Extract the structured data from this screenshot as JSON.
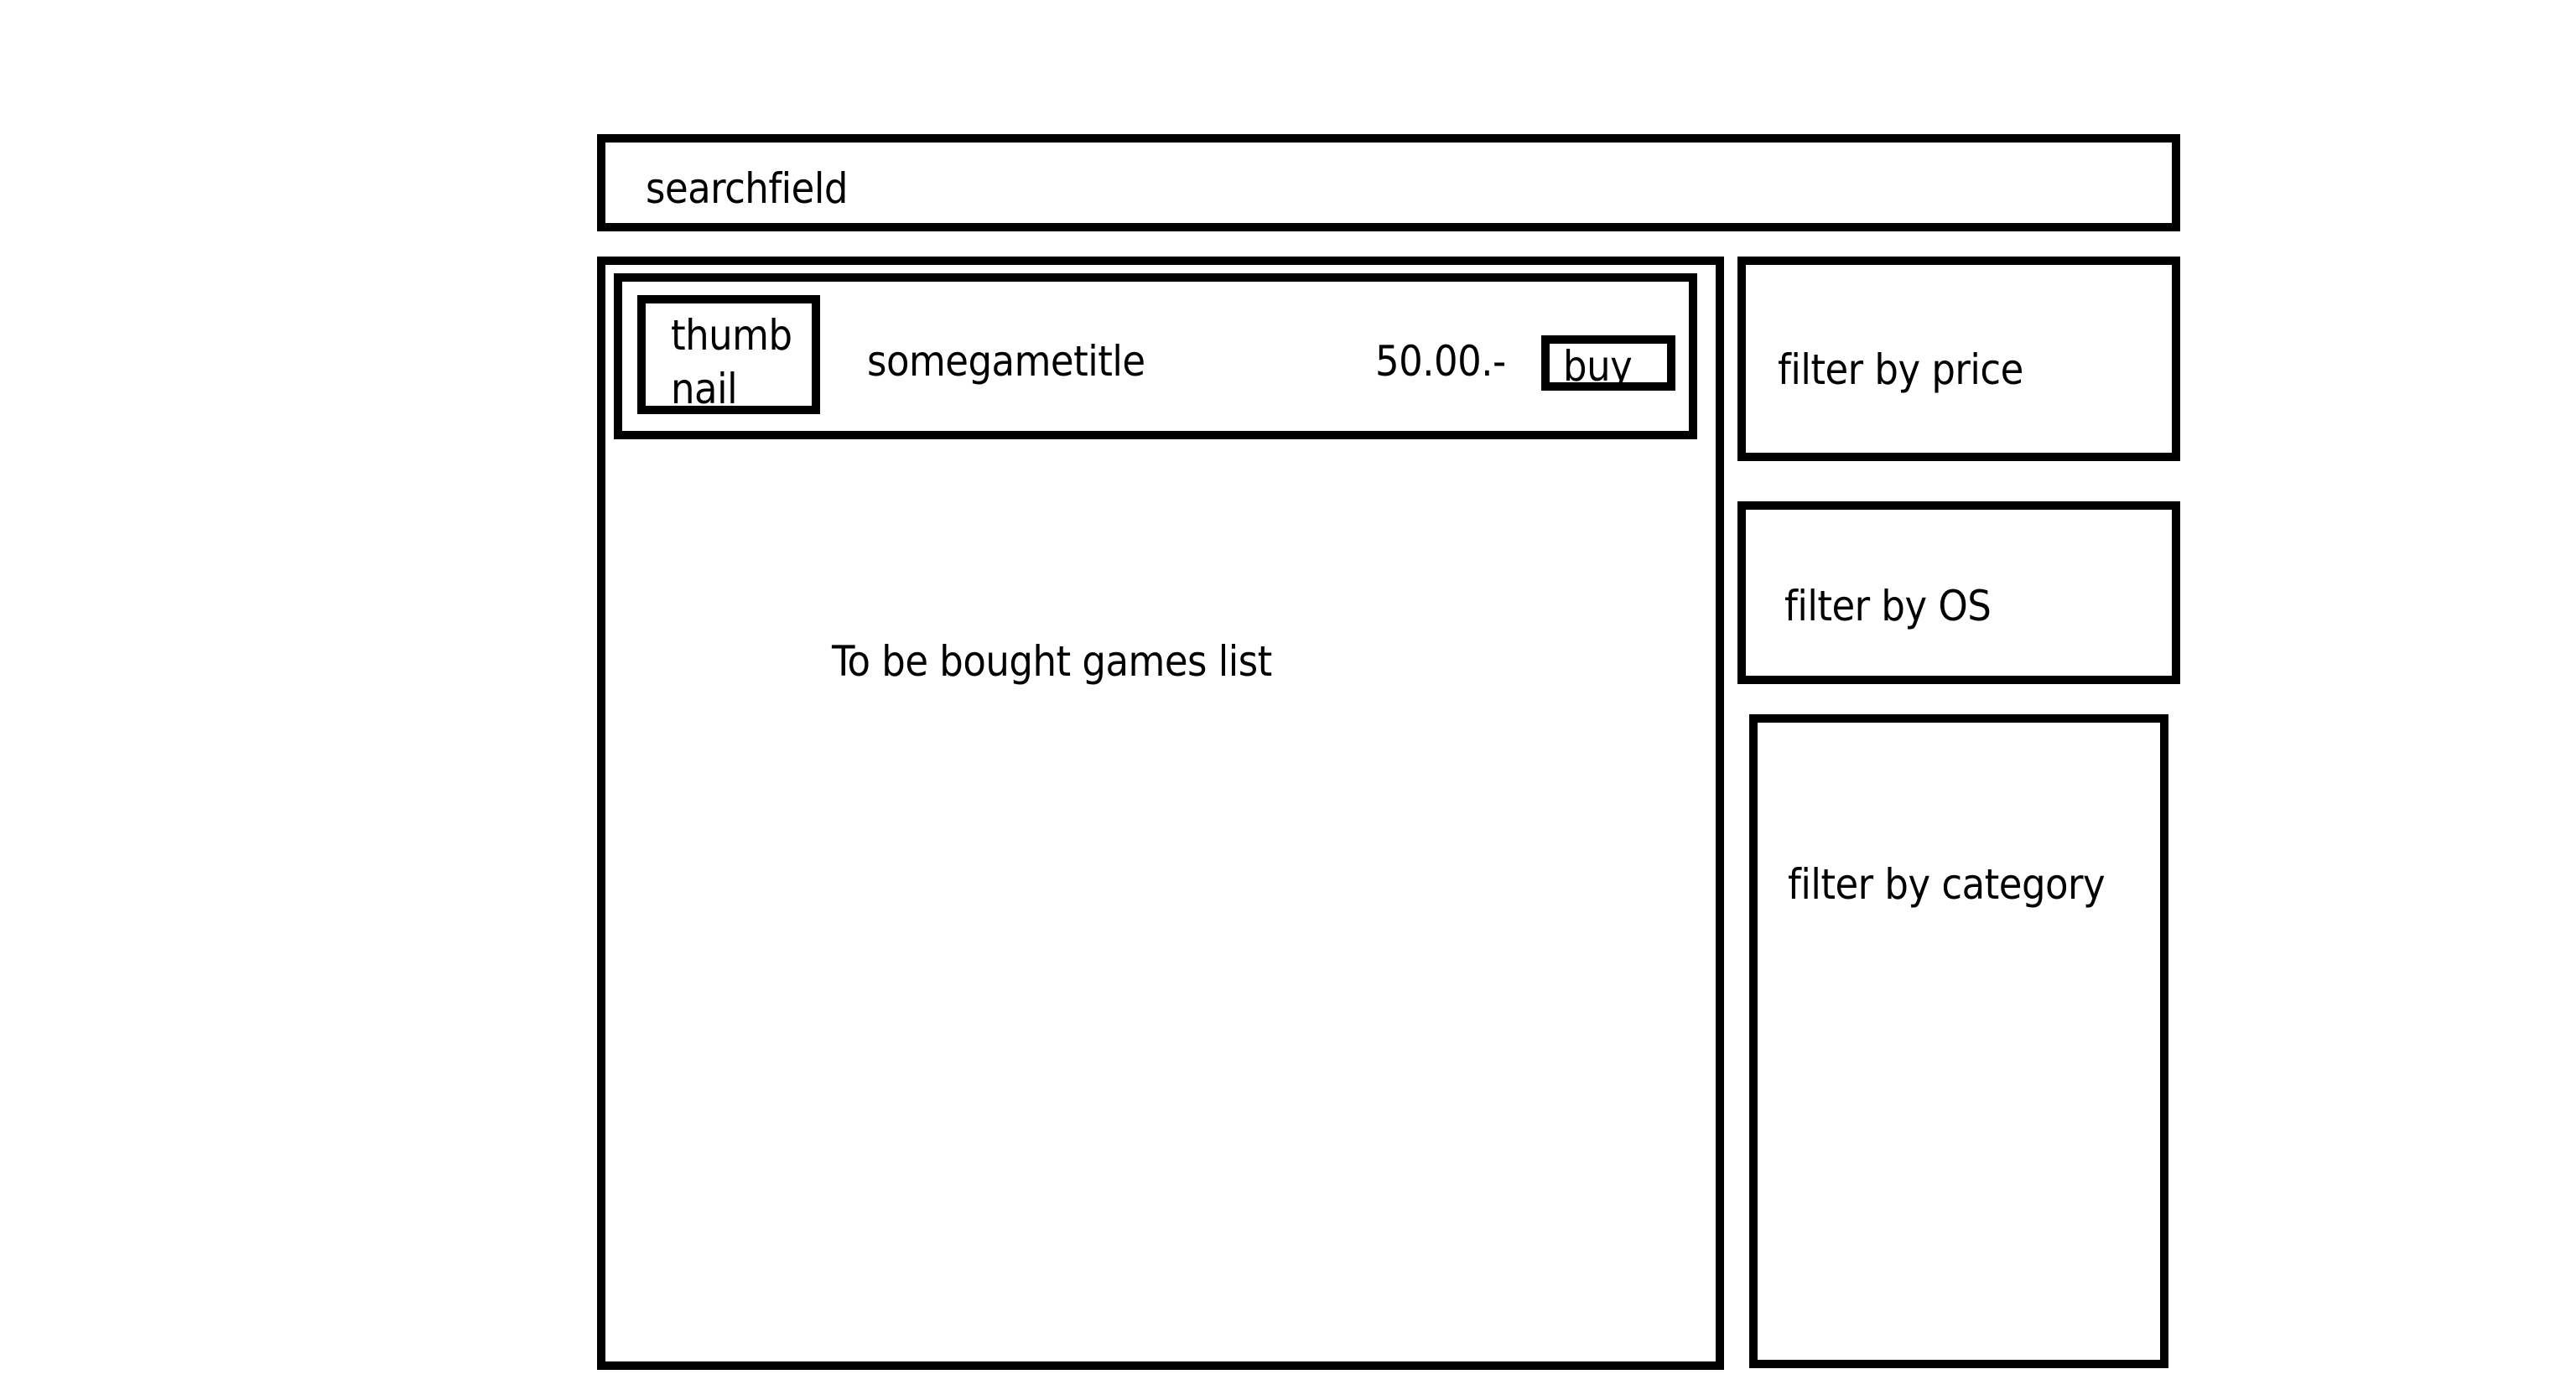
{
  "search": {
    "placeholder": "searchfield"
  },
  "games_list": {
    "label": "To be bought games list",
    "items": [
      {
        "thumbnail_label": "thumb nail",
        "title": "somegametitle",
        "price": "50.00.-",
        "buy_label": "buy"
      }
    ]
  },
  "filters": {
    "price_label": "filter by price",
    "os_label": "filter by OS",
    "category_label": "filter by category"
  },
  "colors": {
    "stroke": "#000000",
    "background": "#ffffff"
  }
}
